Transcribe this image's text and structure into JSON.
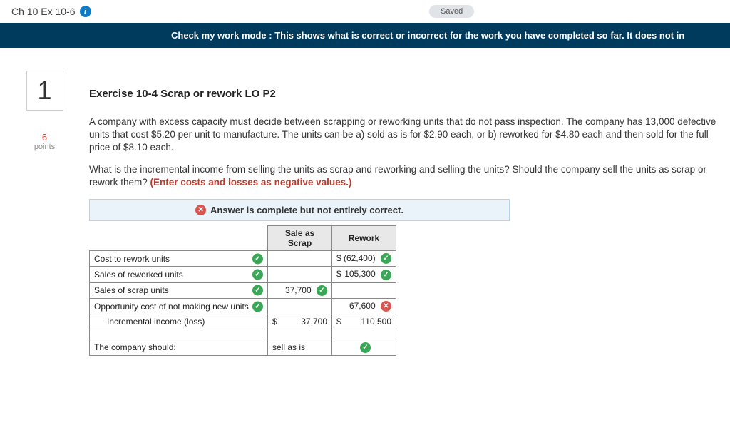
{
  "header": {
    "title": "Ch 10 Ex 10-6",
    "saved": "Saved"
  },
  "banner": "Check my work mode : This shows what is correct or incorrect for the work you have completed so far. It does not in",
  "question": {
    "number": "1",
    "points_value": "6",
    "points_label": "points",
    "title": "Exercise 10-4 Scrap or rework LO P2",
    "para1": "A company with excess capacity must decide between scrapping or reworking units that do not pass inspection. The company has 13,000 defective units that cost $5.20 per unit to manufacture. The units can be a) sold as is for $2.90 each, or b) reworked for $4.80 each and then sold for the full price of $8.10 each.",
    "para2_a": "What is the incremental income from selling the units as scrap and reworking and selling the units? Should the company sell the units as scrap or rework them? ",
    "para2_red": "(Enter costs and losses as negative values.)"
  },
  "answer_status": "Answer is complete but not entirely correct.",
  "table": {
    "col_scrap": "Sale as Scrap",
    "col_rework": "Rework",
    "rows": [
      {
        "label": "Cost to rework units",
        "label_ok": true,
        "scrap": "",
        "rework": "(62,400)",
        "rework_cur": "$",
        "rework_ok": true
      },
      {
        "label": "Sales of reworked units",
        "label_ok": true,
        "scrap": "",
        "rework": "105,300",
        "rework_cur": "$",
        "rework_ok": true
      },
      {
        "label": "Sales of scrap units",
        "label_ok": true,
        "scrap": "37,700",
        "scrap_ok": true,
        "rework": ""
      },
      {
        "label": "Opportunity cost of not making new units",
        "label_ok": true,
        "scrap": "",
        "rework": "67,600",
        "rework_err": true
      }
    ],
    "inc_label": "Incremental income (loss)",
    "inc_scrap_cur": "$",
    "inc_scrap": "37,700",
    "inc_rework_cur": "$",
    "inc_rework": "110,500",
    "decision_label": "The company should:",
    "decision_value": "sell as is",
    "decision_ok": true
  }
}
